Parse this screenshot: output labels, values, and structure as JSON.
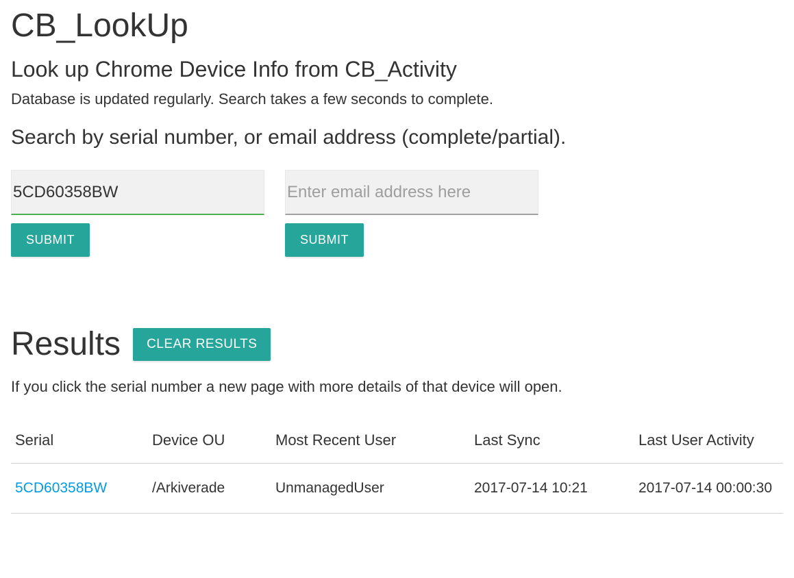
{
  "header": {
    "title": "CB_LookUp",
    "subtitle": "Look up Chrome Device Info from CB_Activity",
    "description": "Database is updated regularly. Search takes a few seconds to complete.",
    "search_heading": "Search by serial number, or email address (complete/partial)."
  },
  "search": {
    "serial": {
      "value": "5CD60358BW",
      "placeholder": "",
      "submit_label": "SUBMIT"
    },
    "email": {
      "value": "",
      "placeholder": "Enter email address here",
      "submit_label": "SUBMIT"
    }
  },
  "results": {
    "title": "Results",
    "clear_label": "CLEAR RESULTS",
    "hint": "If you click the serial number a new page with more details of that device will open.",
    "columns": {
      "serial": "Serial",
      "device_ou": "Device OU",
      "most_recent_user": "Most Recent User",
      "last_sync": "Last Sync",
      "last_user_activity": "Last User Activity"
    },
    "rows": [
      {
        "serial": "5CD60358BW",
        "device_ou": "/Arkiverade",
        "most_recent_user": "UnmanagedUser",
        "last_sync": "2017-07-14 10:21",
        "last_user_activity": "2017-07-14 00:00:30"
      }
    ]
  }
}
